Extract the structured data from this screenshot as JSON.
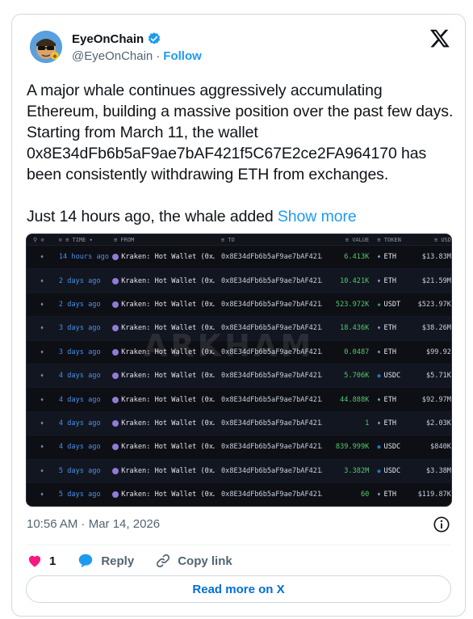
{
  "header": {
    "display_name": "EyeOnChain",
    "handle": "@EyeOnChain",
    "separator": "·",
    "follow_label": "Follow"
  },
  "tweet": {
    "paragraph_1": "A major whale continues aggressively accumulating Ethereum, building a massive position over the past few days. Starting from March 11, the wallet 0x8E34dFb6b5aF9ae7bAF421f5C67E2ce2FA964170 has been consistently withdrawing ETH from exchanges.",
    "paragraph_2": "Just 14 hours ago, the whale added ",
    "show_more": "Show more"
  },
  "media": {
    "columns": {
      "time": "TIME",
      "from": "FROM",
      "to": "TO",
      "value": "VALUE",
      "token": "TOKEN",
      "usd": "USD"
    },
    "watermark": "ARKHAM",
    "rows": [
      {
        "time": "14 hours ago",
        "from": "Kraken: Hot Wallet (0x…",
        "to": "0x8E34dFb6b5aF9ae7bAF421…",
        "value": "6.413K",
        "token": "ETH",
        "usd": "$13.83M"
      },
      {
        "time": "2 days ago",
        "from": "Kraken: Hot Wallet (0x…",
        "to": "0x8E34dFb6b5aF9ae7bAF421…",
        "value": "10.421K",
        "token": "ETH",
        "usd": "$21.59M"
      },
      {
        "time": "2 days ago",
        "from": "Kraken: Hot Wallet (0x…",
        "to": "0x8E34dFb6b5aF9ae7bAF421…",
        "value": "523.972K",
        "token": "USDT",
        "usd": "$523.97K"
      },
      {
        "time": "3 days ago",
        "from": "Kraken: Hot Wallet (0x…",
        "to": "0x8E34dFb6b5aF9ae7bAF421…",
        "value": "18.436K",
        "token": "ETH",
        "usd": "$38.26M"
      },
      {
        "time": "3 days ago",
        "from": "Kraken: Hot Wallet (0x…",
        "to": "0x8E34dFb6b5aF9ae7bAF421…",
        "value": "0.0487",
        "token": "ETH",
        "usd": "$99.92"
      },
      {
        "time": "4 days ago",
        "from": "Kraken: Hot Wallet (0x…",
        "to": "0x8E34dFb6b5aF9ae7bAF421…",
        "value": "5.706K",
        "token": "USDC",
        "usd": "$5.71K"
      },
      {
        "time": "4 days ago",
        "from": "Kraken: Hot Wallet (0x…",
        "to": "0x8E34dFb6b5aF9ae7bAF421…",
        "value": "44.888K",
        "token": "ETH",
        "usd": "$92.97M"
      },
      {
        "time": "4 days ago",
        "from": "Kraken: Hot Wallet (0x…",
        "to": "0x8E34dFb6b5aF9ae7bAF421…",
        "value": "1",
        "token": "ETH",
        "usd": "$2.03K"
      },
      {
        "time": "4 days ago",
        "from": "Kraken: Hot Wallet (0x…",
        "to": "0x8E34dFb6b5aF9ae7bAF421…",
        "value": "839.999K",
        "token": "USDC",
        "usd": "$840K"
      },
      {
        "time": "5 days ago",
        "from": "Kraken: Hot Wallet (0x…",
        "to": "0x8E34dFb6b5aF9ae7bAF421…",
        "value": "3.382M",
        "token": "USDC",
        "usd": "$3.38M"
      },
      {
        "time": "5 days ago",
        "from": "Kraken: Hot Wallet (0x…",
        "to": "0x8E34dFb6b5aF9ae7bAF421…",
        "value": "60",
        "token": "ETH",
        "usd": "$119.87K"
      }
    ]
  },
  "footer": {
    "timestamp": "10:56 AM · Mar 14, 2026",
    "like_count": "1",
    "reply_label": "Reply",
    "copy_link_label": "Copy link",
    "read_more_label": "Read more on X"
  },
  "colors": {
    "accent": "#1d9bf0",
    "like": "#f91880",
    "value_green": "#54c86b"
  }
}
